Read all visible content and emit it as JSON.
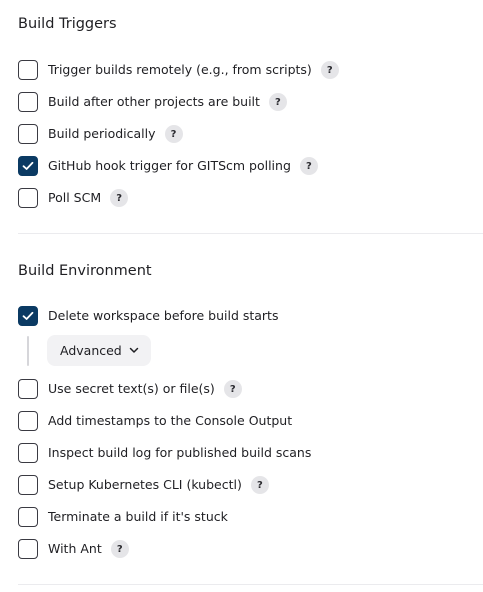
{
  "build_triggers": {
    "title": "Build Triggers",
    "options": [
      {
        "label": "Trigger builds remotely (e.g., from scripts)",
        "checked": false,
        "has_help": true
      },
      {
        "label": "Build after other projects are built",
        "checked": false,
        "has_help": true
      },
      {
        "label": "Build periodically",
        "checked": false,
        "has_help": true
      },
      {
        "label": "GitHub hook trigger for GITScm polling",
        "checked": true,
        "has_help": true
      },
      {
        "label": "Poll SCM",
        "checked": false,
        "has_help": true
      }
    ]
  },
  "build_environment": {
    "title": "Build Environment",
    "delete_workspace": {
      "label": "Delete workspace before build starts",
      "checked": true
    },
    "advanced_button": {
      "label": "Advanced",
      "icon": "chevron-down-icon"
    },
    "options": [
      {
        "label": "Use secret text(s) or file(s)",
        "checked": false,
        "has_help": true
      },
      {
        "label": "Add timestamps to the Console Output",
        "checked": false,
        "has_help": false
      },
      {
        "label": "Inspect build log for published build scans",
        "checked": false,
        "has_help": false
      },
      {
        "label": "Setup Kubernetes CLI (kubectl)",
        "checked": false,
        "has_help": true
      },
      {
        "label": "Terminate a build if it's stuck",
        "checked": false,
        "has_help": false
      },
      {
        "label": "With Ant",
        "checked": false,
        "has_help": true
      }
    ]
  },
  "help_glyph": "?",
  "colors": {
    "checked_fill": "#0b3a63",
    "help_bg": "#e5e5e8",
    "advanced_bg": "#f2f2f4",
    "divider": "#ebebee"
  }
}
